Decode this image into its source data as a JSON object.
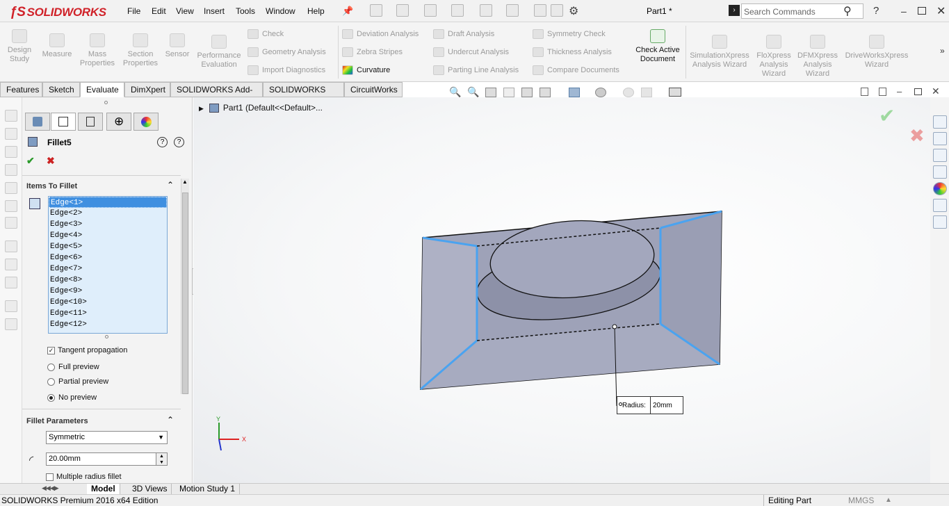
{
  "app": {
    "logo_text": "SOLIDWORKS",
    "doc_title": "Part1 *"
  },
  "menu": [
    "File",
    "Edit",
    "View",
    "Insert",
    "Tools",
    "Window",
    "Help"
  ],
  "search": {
    "placeholder": "Search Commands"
  },
  "ribbon": {
    "design_study": "Design Study",
    "measure": "Measure",
    "mass_properties": "Mass Properties",
    "section_properties": "Section Properties",
    "sensor": "Sensor",
    "performance_evaluation": "Performance Evaluation",
    "check": "Check",
    "geometry_analysis": "Geometry Analysis",
    "import_diagnostics": "Import Diagnostics",
    "deviation_analysis": "Deviation Analysis",
    "zebra_stripes": "Zebra Stripes",
    "curvature": "Curvature",
    "draft_analysis": "Draft Analysis",
    "undercut_analysis": "Undercut Analysis",
    "parting_line_analysis": "Parting Line Analysis",
    "symmetry_check": "Symmetry Check",
    "thickness_analysis": "Thickness Analysis",
    "compare_documents": "Compare Documents",
    "check_active_document": "Check Active Document",
    "simulationxpress": "SimulationXpress Analysis Wizard",
    "floxpress": "FloXpress Analysis Wizard",
    "dfmxpress": "DFMXpress Analysis Wizard",
    "driveworksxpress": "DriveWorksXpress Wizard"
  },
  "tabs": [
    "Features",
    "Sketch",
    "Evaluate",
    "DimXpert",
    "SOLIDWORKS Add-Ins",
    "SOLIDWORKS MBD",
    "CircuitWorks"
  ],
  "property_manager": {
    "title": "Fillet5",
    "items_section": "Items To Fillet",
    "edges": [
      "Edge<1>",
      "Edge<2>",
      "Edge<3>",
      "Edge<4>",
      "Edge<5>",
      "Edge<6>",
      "Edge<7>",
      "Edge<8>",
      "Edge<9>",
      "Edge<10>",
      "Edge<11>",
      "Edge<12>"
    ],
    "tangent_propagation": "Tangent propagation",
    "full_preview": "Full preview",
    "partial_preview": "Partial preview",
    "no_preview": "No preview",
    "params_section": "Fillet Parameters",
    "fillet_type": "Symmetric",
    "radius_value": "20.00mm",
    "multiple_radius": "Multiple radius fillet"
  },
  "viewport": {
    "tree_label": "Part1  (Default<<Default>...",
    "callout_label": "Radius:",
    "callout_value": "20mm",
    "axis_x": "X",
    "axis_y": "Y"
  },
  "bottom_tabs": [
    "Model",
    "3D Views",
    "Motion Study 1"
  ],
  "status": {
    "edition": "SOLIDWORKS Premium 2016 x64 Edition",
    "mode": "Editing Part",
    "units": "MMGS"
  },
  "colors": {
    "brand": "#d02229",
    "edge_highlight": "#4aa3f0",
    "part_face": "#a1a5bb"
  }
}
